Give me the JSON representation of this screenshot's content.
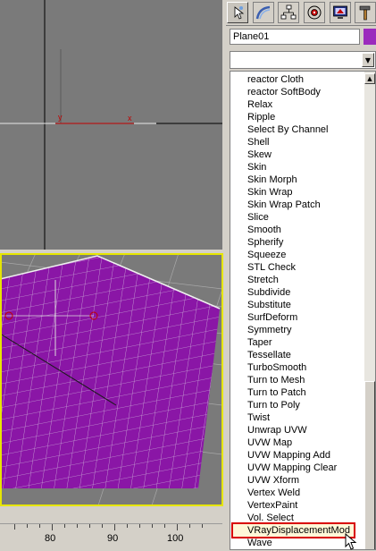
{
  "command_panel": {
    "tabs": [
      {
        "name": "create-tab",
        "icon": "cursor-pointer-icon"
      },
      {
        "name": "modify-tab",
        "icon": "modify-arc-icon"
      },
      {
        "name": "hierarchy-tab",
        "icon": "hierarchy-icon"
      },
      {
        "name": "motion-tab",
        "icon": "motion-icon"
      },
      {
        "name": "display-tab",
        "icon": "display-monitor-icon"
      },
      {
        "name": "utilities-tab",
        "icon": "hammer-icon"
      }
    ],
    "object_name": "Plane01",
    "object_color": "#9b2bbd",
    "modifier_dropdown_value": ""
  },
  "modifier_list": {
    "items": [
      "reactor Cloth",
      "reactor SoftBody",
      "Relax",
      "Ripple",
      "Select By Channel",
      "Shell",
      "Skew",
      "Skin",
      "Skin Morph",
      "Skin Wrap",
      "Skin Wrap Patch",
      "Slice",
      "Smooth",
      "Spherify",
      "Squeeze",
      "STL Check",
      "Stretch",
      "Subdivide",
      "Substitute",
      "SurfDeform",
      "Symmetry",
      "Taper",
      "Tessellate",
      "TurboSmooth",
      "Turn to Mesh",
      "Turn to Patch",
      "Turn to Poly",
      "Twist",
      "Unwrap UVW",
      "UVW Map",
      "UVW Mapping Add",
      "UVW Mapping Clear",
      "UVW Xform",
      "Vertex Weld",
      "VertexPaint",
      "Vol. Select",
      "VRayDisplacementMod",
      "Wave"
    ],
    "selected": "VRayDisplacementMod"
  },
  "viewports": {
    "top_axis_x": "x",
    "top_axis_y": "y",
    "plane_color": "#8a16a6",
    "active_border_color": "#e6e600"
  },
  "timeline": {
    "labels": [
      "80",
      "90",
      "100"
    ]
  }
}
